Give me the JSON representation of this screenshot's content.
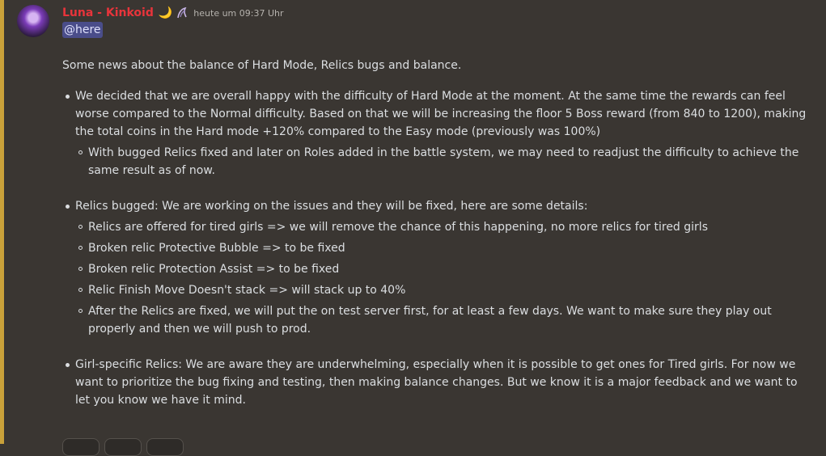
{
  "message": {
    "author": "Luna - Kinkoid",
    "badge_moon": "🌙",
    "timestamp": "heute um 09:37 Uhr",
    "mention": "@here",
    "intro": "Some news about the balance of Hard Mode, Relics bugs and balance.",
    "bullets": [
      {
        "text": "We decided that we are overall happy with the difficulty of Hard Mode at the moment. At the same time the rewards can feel worse compared to the Normal difficulty. Based on that we will be increasing the floor 5 Boss reward (from 840 to 1200), making the total coins in the Hard mode +120% compared to the Easy mode (previously was 100%)",
        "sub": [
          "With bugged Relics fixed and later on Roles added in the battle system, we may need to readjust the difficulty to achieve the same result as of now."
        ]
      },
      {
        "text": "Relics bugged: We are working on the issues and they will be fixed, here are some details:",
        "sub": [
          "Relics are offered for tired girls => we will remove the chance of this happening, no more relics for tired girls",
          "Broken relic Protective Bubble => to be fixed",
          "Broken relic Protection Assist => to be fixed",
          "Relic Finish Move Doesn't stack => will stack up to 40%",
          "After the Relics are fixed, we will put the on test server first, for at least a few days. We want to make sure they play out properly and then we will push to prod."
        ]
      },
      {
        "text": "Girl-specific Relics: We are aware they are underwhelming, especially when it is possible to get ones for Tired girls. For now we want to prioritize the bug fixing and testing, then making balance changes. But we know it is a major feedback and we want to let you know we have it mind.",
        "sub": []
      }
    ]
  },
  "colors": {
    "background": "#3a3632",
    "mention_bar": "#c9a13a",
    "username": "#e8343b"
  },
  "icons": [
    "avatar",
    "moon-badge-icon",
    "role-badge-icon"
  ]
}
